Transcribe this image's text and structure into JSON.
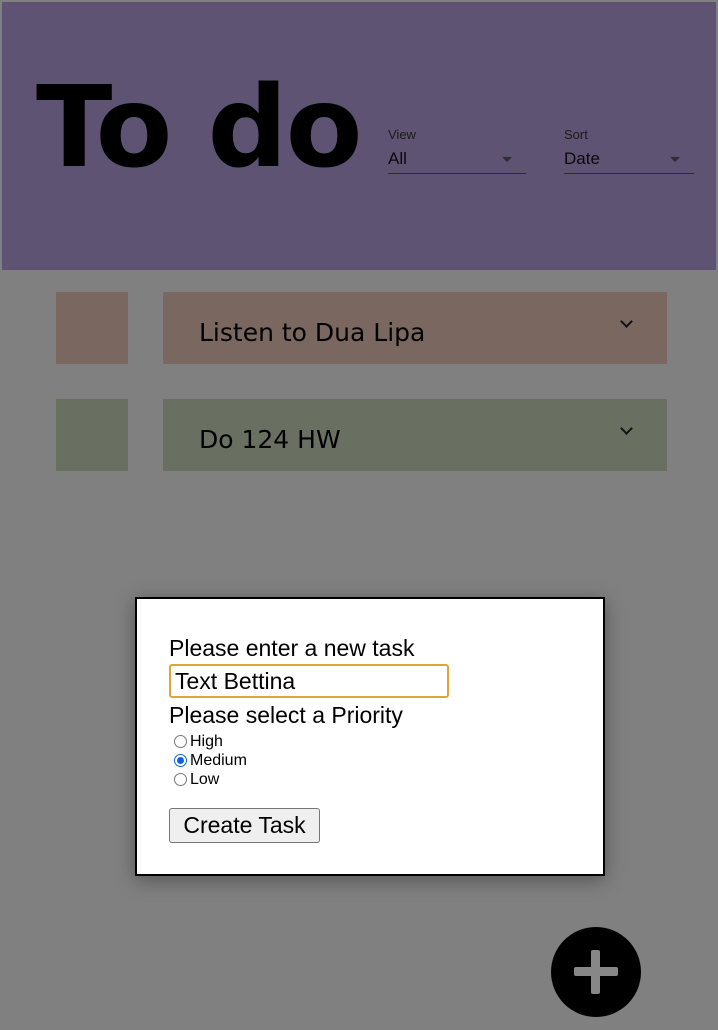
{
  "header": {
    "title": "To do",
    "view": {
      "label": "View",
      "value": "All"
    },
    "sort": {
      "label": "Sort",
      "value": "Date"
    }
  },
  "tasks": [
    {
      "text": "Listen to Dua Lipa",
      "priority_color": "#e7c2b4",
      "card_color": "#e7c2b4"
    },
    {
      "text": "Do 124 HW",
      "priority_color": "#c8d4b7",
      "card_color": "#c8d4b7"
    }
  ],
  "modal": {
    "task_label": "Please enter a new task",
    "task_value": "Text Bettina",
    "priority_label": "Please select a Priority",
    "priorities": [
      {
        "label": "High",
        "checked": false
      },
      {
        "label": "Medium",
        "checked": true
      },
      {
        "label": "Low",
        "checked": false
      }
    ],
    "create_label": "Create Task"
  },
  "colors": {
    "header_bg": "#b39ddb",
    "page_bg": "#f1f1f1",
    "input_focus": "#e0a43a",
    "radio_accent": "#0a64e0"
  },
  "icons": {
    "fab": "plus-icon",
    "task_expand": "chevron-down-icon",
    "select_dropdown": "caret-down-icon"
  }
}
